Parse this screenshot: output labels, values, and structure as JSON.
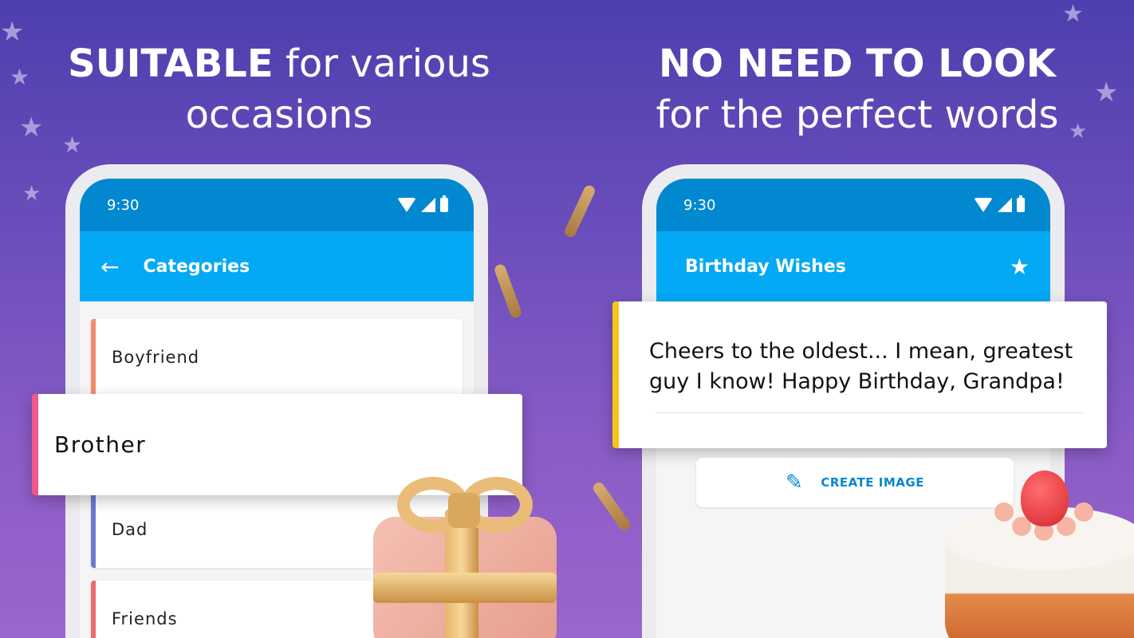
{
  "colors": {
    "statusbar": "#0288d1",
    "appbar": "#03a9f4",
    "accent_boyfriend": "#f38b73",
    "accent_brother": "#f0578a",
    "accent_dad": "#6c7bd2",
    "accent_friends": "#f06b6b",
    "accent_wish": "#f5c518"
  },
  "left_headline": {
    "bold": "SUITABLE",
    "rest": "for various",
    "line2": "occasions"
  },
  "right_headline": {
    "line1": "NO NEED TO LOOK",
    "line2": "for the perfect words"
  },
  "left_phone": {
    "time": "9:30",
    "title": "Categories",
    "back_icon": "arrow-back-icon",
    "categories": [
      "Boyfriend",
      "Dad",
      "Friends"
    ]
  },
  "floating_category": "Brother",
  "right_phone": {
    "time": "9:30",
    "title": "Birthday Wishes",
    "star_icon": "star-icon",
    "wish_text": "Cheers to the oldest... I mean, greatest guy I know! Happy Birthday, Grandpa!",
    "create_button": "CREATE IMAGE",
    "pencil_icon": "pencil-icon"
  }
}
